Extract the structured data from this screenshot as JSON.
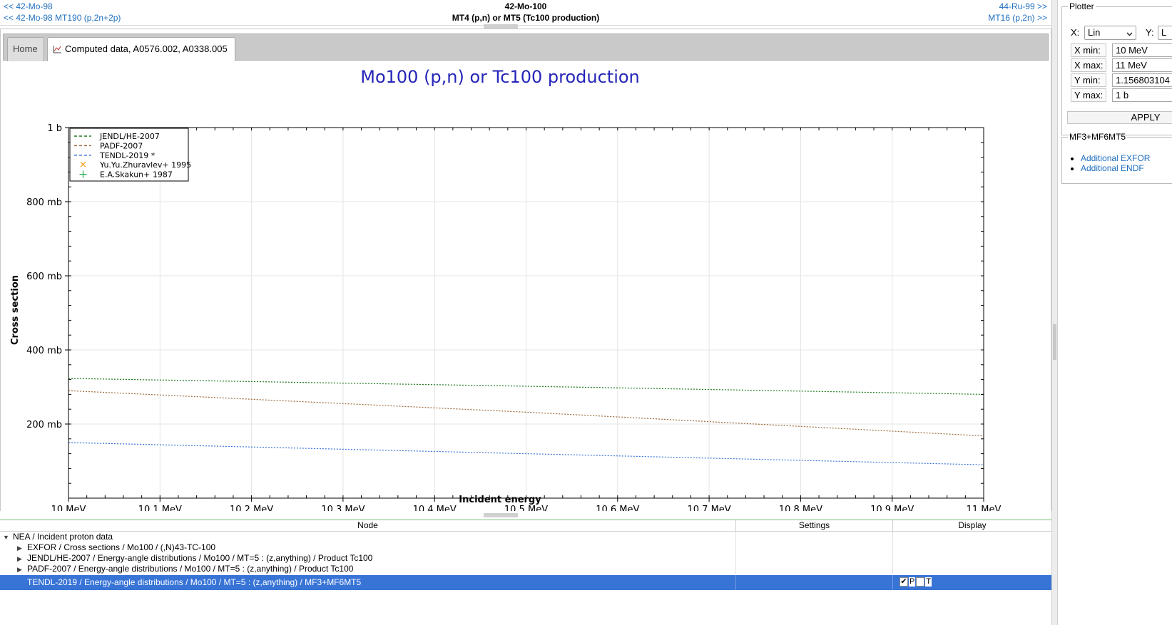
{
  "nav": {
    "prev_element": "<< 42-Mo-98",
    "prev_mt": "<< 42-Mo-98 MT190 (p,2n+2p)",
    "title": "42-Mo-100",
    "subtitle": "MT4 (p,n) or MT5 (Tc100 production)",
    "next_element": "44-Ru-99 >>",
    "next_mt": "MT16 (p,2n) >>"
  },
  "tabs": [
    {
      "label": "Home",
      "active": false
    },
    {
      "label": "Computed data, A0576.002, A0338.005",
      "active": true,
      "icon": "chart-icon"
    }
  ],
  "chart_data": {
    "type": "line",
    "title": "Mo100 (p,n) or Tc100 production",
    "xlabel": "Incident energy",
    "ylabel": "Cross section",
    "xlim": [
      10,
      11
    ],
    "ylim": [
      0,
      1000
    ],
    "x_unit": "MeV",
    "y_unit": "mb",
    "grid": true,
    "legend_position": "top-left",
    "x_ticks": [
      {
        "value": 10.0,
        "label": "10 MeV"
      },
      {
        "value": 10.1,
        "label": "10.1 MeV"
      },
      {
        "value": 10.2,
        "label": "10.2 MeV"
      },
      {
        "value": 10.3,
        "label": "10.3 MeV"
      },
      {
        "value": 10.4,
        "label": "10.4 MeV"
      },
      {
        "value": 10.5,
        "label": "10.5 MeV"
      },
      {
        "value": 10.6,
        "label": "10.6 MeV"
      },
      {
        "value": 10.7,
        "label": "10.7 MeV"
      },
      {
        "value": 10.8,
        "label": "10.8 MeV"
      },
      {
        "value": 10.9,
        "label": "10.9 MeV"
      },
      {
        "value": 11.0,
        "label": "11 MeV"
      }
    ],
    "y_ticks": [
      {
        "value": 200,
        "label": "200 mb"
      },
      {
        "value": 400,
        "label": "400 mb"
      },
      {
        "value": 600,
        "label": "600 mb"
      },
      {
        "value": 800,
        "label": "800 mb"
      },
      {
        "value": 1000,
        "label": "1 b"
      }
    ],
    "series": [
      {
        "name": "JENDL/HE-2007",
        "style": "dashed-line",
        "color": "#1e7a1e",
        "x": [
          10,
          10.5,
          11
        ],
        "y": [
          323,
          302,
          280
        ]
      },
      {
        "name": "PADF-2007",
        "style": "dashed-line",
        "color": "#9c6a3c",
        "x": [
          10,
          10.5,
          11
        ],
        "y": [
          290,
          232,
          168
        ]
      },
      {
        "name": "TENDL-2019 *",
        "style": "dashed-line",
        "color": "#3a72d8",
        "x": [
          10,
          10.5,
          11
        ],
        "y": [
          150,
          120,
          90
        ]
      },
      {
        "name": "Yu.Yu.Zhuravlev+ 1995",
        "style": "marker-x",
        "color": "#f0a020",
        "x": [],
        "y": []
      },
      {
        "name": "E.A.Skakun+ 1987",
        "style": "marker-plus",
        "color": "#28b050",
        "x": [],
        "y": []
      }
    ]
  },
  "plotter": {
    "legend": "Plotter",
    "x_scale_label": "X:",
    "x_scale_value": "Lin",
    "y_scale_label": "Y:",
    "y_scale_value": "L",
    "limits": [
      {
        "label": "X min:",
        "value": "10 MeV"
      },
      {
        "label": "X max:",
        "value": "11 MeV"
      },
      {
        "label": "Y min:",
        "value": "1.156803104"
      },
      {
        "label": "Y max:",
        "value": "1 b"
      }
    ],
    "apply_label": "APPLY"
  },
  "mf_group": {
    "legend": "MF3+MF6MT5",
    "links": [
      "Additional EXFOR",
      "Additional ENDF"
    ]
  },
  "tree": {
    "columns": [
      "Node",
      "Settings",
      "Display"
    ],
    "rows": [
      {
        "label": "NEA / Incident proton data",
        "expander": "▼"
      },
      {
        "label": "EXFOR / Cross sections / Mo100 / (,N)43-TC-100",
        "expander": "▶"
      },
      {
        "label": "JENDL/HE-2007 / Energy-angle distributions / Mo100 / MT=5 : (z,anything) / Product Tc100",
        "expander": "▶"
      },
      {
        "label": "PADF-2007 / Energy-angle distributions / Mo100 / MT=5 : (z,anything) / Product Tc100",
        "expander": "▶"
      },
      {
        "label": "TENDL-2019 / Energy-angle distributions / Mo100 / MT=5 : (z,anything) / MF3+MF6MT5",
        "expander": ""
      }
    ],
    "display_flags": {
      "check": "✔",
      "p": "P",
      "t": "T"
    }
  }
}
